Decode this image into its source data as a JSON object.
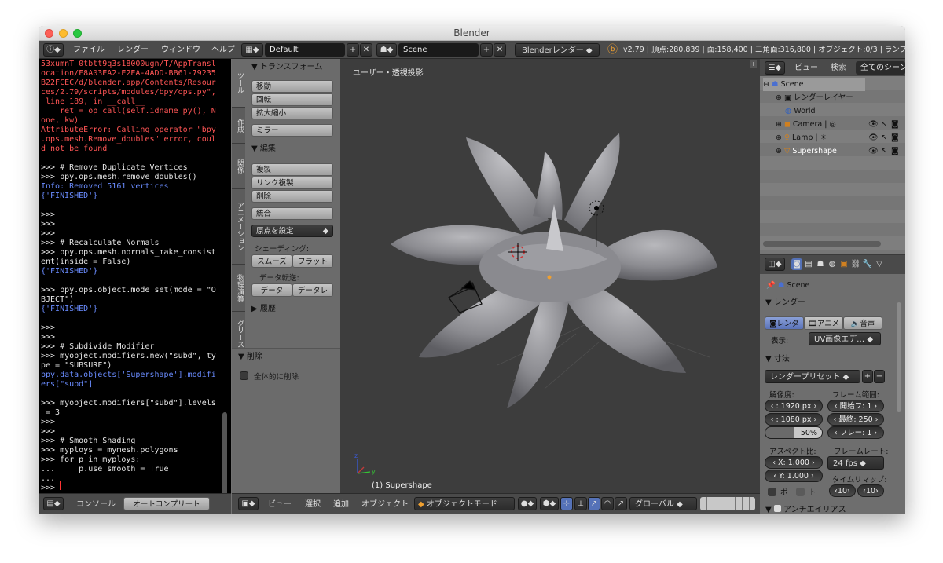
{
  "window": {
    "title": "Blender"
  },
  "infobar": {
    "menus": [
      "ファイル",
      "レンダー",
      "ウィンドウ",
      "ヘルプ"
    ],
    "layout": "Default",
    "scene": "Scene",
    "engine": "Blenderレンダー",
    "stats": "v2.79 | 頂点:280,839 | 面:158,400 | 三角面:316,800 | オブジェクト:0/3 | ランプ"
  },
  "console": {
    "lines": [
      {
        "t": "53xumnT_0tbtt9q3s18000ugn/T/AppTransl",
        "c": "err"
      },
      {
        "t": "ocation/F8A03EA2-E2EA-4ADD-BB61-79235",
        "c": "err"
      },
      {
        "t": "B22FCEC/d/blender.app/Contents/Resour",
        "c": "err"
      },
      {
        "t": "ces/2.79/scripts/modules/bpy/ops.py\",",
        "c": "err"
      },
      {
        "t": " line 189, in __call__",
        "c": "err"
      },
      {
        "t": "    ret = op_call(self.idname_py(), N",
        "c": "err"
      },
      {
        "t": "one, kw)",
        "c": "err"
      },
      {
        "t": "AttributeError: Calling operator \"bpy",
        "c": "err"
      },
      {
        "t": ".ops.mesh.Remove_doubles\" error, coul",
        "c": "err"
      },
      {
        "t": "d not be found",
        "c": "err"
      },
      {
        "t": "",
        "c": ""
      },
      {
        "t": ">>> # Remove Duplicate Vertices",
        "c": ""
      },
      {
        "t": ">>> bpy.ops.mesh.remove_doubles()",
        "c": ""
      },
      {
        "t": "Info: Removed 5161 vertices",
        "c": "inf"
      },
      {
        "t": "{'FINISHED'}",
        "c": "inf"
      },
      {
        "t": "",
        "c": ""
      },
      {
        "t": ">>>",
        "c": ""
      },
      {
        "t": ">>>",
        "c": ""
      },
      {
        "t": ">>>",
        "c": ""
      },
      {
        "t": ">>> # Recalculate Normals",
        "c": ""
      },
      {
        "t": ">>> bpy.ops.mesh.normals_make_consist",
        "c": ""
      },
      {
        "t": "ent(inside = False)",
        "c": ""
      },
      {
        "t": "{'FINISHED'}",
        "c": "inf"
      },
      {
        "t": "",
        "c": ""
      },
      {
        "t": ">>> bpy.ops.object.mode_set(mode = \"O",
        "c": ""
      },
      {
        "t": "BJECT\")",
        "c": ""
      },
      {
        "t": "{'FINISHED'}",
        "c": "inf"
      },
      {
        "t": "",
        "c": ""
      },
      {
        "t": ">>>",
        "c": ""
      },
      {
        "t": ">>>",
        "c": ""
      },
      {
        "t": ">>> # Subdivide Modifier",
        "c": ""
      },
      {
        "t": ">>> myobject.modifiers.new(\"subd\", ty",
        "c": ""
      },
      {
        "t": "pe = \"SUBSURF\")",
        "c": ""
      },
      {
        "t": "bpy.data.objects['Supershape'].modifi",
        "c": "inf"
      },
      {
        "t": "ers[\"subd\"]",
        "c": "inf"
      },
      {
        "t": "",
        "c": ""
      },
      {
        "t": ">>> myobject.modifiers[\"subd\"].levels",
        "c": ""
      },
      {
        "t": " = 3",
        "c": ""
      },
      {
        "t": ">>>",
        "c": ""
      },
      {
        "t": ">>>",
        "c": ""
      },
      {
        "t": ">>> # Smooth Shading",
        "c": ""
      },
      {
        "t": ">>> myploys = mymesh.polygons",
        "c": ""
      },
      {
        "t": ">>> for p in myploys:",
        "c": ""
      },
      {
        "t": "...     p.use_smooth = True",
        "c": ""
      },
      {
        "t": "...",
        "c": ""
      },
      {
        "t": ">>> ",
        "c": ""
      }
    ],
    "header": {
      "label": "コンソール",
      "autocomplete": "オートコンプリート"
    }
  },
  "vertical_tabs": [
    "ツール",
    "作成",
    "関係",
    "アニメーション",
    "物理演算",
    "グリースペンシル"
  ],
  "tool_shelf": {
    "transform": {
      "title": "トランスフォーム",
      "buttons": [
        "移動",
        "回転",
        "拡大縮小"
      ],
      "mirror": "ミラー"
    },
    "edit": {
      "title": "編集",
      "buttons": [
        "複製",
        "リンク複製",
        "削除"
      ],
      "join": "統合",
      "origin": "原点を設定",
      "shading_label": "シェーディング:",
      "smooth": "スムーズ",
      "flat": "フラット",
      "data_label": "データ転送:",
      "data": "データ",
      "data_layout": "データレ"
    },
    "history": "履歴",
    "delete_panel": {
      "title": "削除",
      "checkbox": "全体的に削除"
    }
  },
  "viewport": {
    "view_label": "ユーザー・透視投影",
    "object_label": "(1) Supershape",
    "header": {
      "view": "ビュー",
      "select": "選択",
      "add": "追加",
      "object": "オブジェクト",
      "mode": "オブジェクトモード",
      "orientation": "グローバル"
    }
  },
  "outliner": {
    "header": {
      "view": "ビュー",
      "search": "検索",
      "filter": "全てのシーン"
    },
    "items": [
      {
        "label": "Scene",
        "depth": 0
      },
      {
        "label": "レンダーレイヤー",
        "depth": 1
      },
      {
        "label": "World",
        "depth": 1
      },
      {
        "label": "Camera",
        "depth": 1
      },
      {
        "label": "Lamp",
        "depth": 1
      },
      {
        "label": "Supershape",
        "depth": 1
      }
    ]
  },
  "properties": {
    "breadcrumb": "Scene",
    "render_panel": {
      "title": "レンダー",
      "render": "レンダ",
      "anim": "アニメ",
      "audio": "音声",
      "display_label": "表示:",
      "display_value": "UV画像エデ…"
    },
    "dimensions": {
      "title": "寸法",
      "preset": "レンダープリセット",
      "resolution_label": "解像度:",
      "res_x": "1920 px",
      "res_y": "1080 px",
      "percent": "50%",
      "frame_range_label": "フレーム範囲:",
      "start": "開始フ:",
      "start_v": "1",
      "end": "最終:",
      "end_v": "250",
      "step": "フレー:",
      "step_v": "1",
      "aspect_label": "アスペクト比:",
      "asp_x": "1.000",
      "asp_y": "1.000",
      "framerate_label": "フレームレート:",
      "fps": "24 fps",
      "remap_label": "タイムリマップ:",
      "remap_old": "10",
      "remap_new": "10",
      "border": "ボ",
      "crop": "ト"
    },
    "antialias": "アンチエイリアス"
  }
}
